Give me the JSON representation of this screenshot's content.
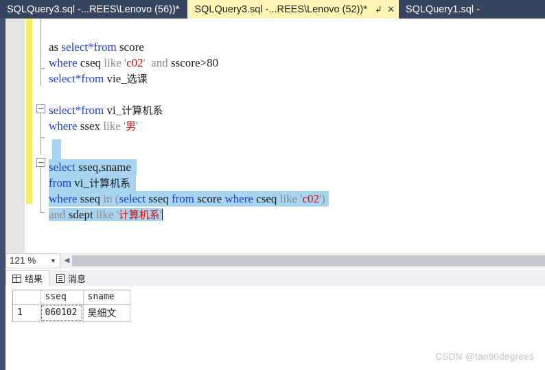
{
  "tabs": [
    {
      "label": "SQLQuery3.sql -...REES\\Lenovo (56))*",
      "active": false
    },
    {
      "label": "SQLQuery3.sql -...REES\\Lenovo (52))*",
      "active": true
    },
    {
      "label": "SQLQuery1.sql -",
      "active": false
    }
  ],
  "tab_icons": {
    "pin": "↲",
    "close": "✕"
  },
  "editor": {
    "lines": [
      "as select*from score",
      "where cseq like 'c02'  and sscore>80",
      "select*from vie_选课",
      "",
      "select*from vi_计算机系",
      "where ssex like '男'",
      "",
      "",
      "select sseq,sname",
      "from vi_计算机系",
      "where sseq in (select sseq from score where cseq like 'c02')",
      "and sdept like '计算机系'"
    ],
    "l1": {
      "w1": "as ",
      "w2": "select*from",
      "w3": " score"
    },
    "l2": {
      "w1": "where",
      "w2": " cseq ",
      "w3": "like",
      "w4": " '",
      "w5": "c02",
      "w6": "'",
      "w7": "  and ",
      "w8": "sscore>80"
    },
    "l3": {
      "w1": "select*from",
      "w2": " vie_",
      "w3": "选课"
    },
    "l5": {
      "w1": "select*from",
      "w2": " vi_",
      "w3": "计算机系"
    },
    "l6": {
      "w1": "where",
      "w2": " ssex ",
      "w3": "like",
      "w4": " '",
      "w5": "男",
      "w6": "'"
    },
    "l9": {
      "w1": "select",
      "w2": " sseq,sname"
    },
    "l10": {
      "w1": "from",
      "w2": " vi_",
      "w3": "计算机系"
    },
    "l11": {
      "w1": "where",
      "w2": " sseq ",
      "w3": "in",
      "w4": " (",
      "w5": "select",
      "w6": " sseq ",
      "w7": "from",
      "w8": " score ",
      "w9": "where",
      "w10": " cseq ",
      "w11": "like",
      "w12": " '",
      "w13": "c02",
      "w14": "')"
    },
    "l12": {
      "w1": "and",
      "w2": " sdept ",
      "w3": "like",
      "w4": " '",
      "w5": "计算机系",
      "w6": "'"
    }
  },
  "status": {
    "zoom": "121 %",
    "zoom_caret": "▼",
    "scroll_left_arrow": "◀"
  },
  "results_tabs": [
    {
      "label": "结果",
      "icon": "grid-icon",
      "active": true
    },
    {
      "label": "消息",
      "icon": "message-icon",
      "active": false
    }
  ],
  "results_grid": {
    "columns": [
      "",
      "sseq",
      "sname"
    ],
    "rows": [
      {
        "num": "1",
        "sseq": "060102",
        "sname": "吴细文"
      }
    ]
  },
  "watermark": "CSDN @tan90degrees",
  "colors": {
    "tab_bar": "#37465e",
    "active_tab": "#fdf6b4",
    "selection": "#a8d4f0",
    "change_bar": "#f7eb6a",
    "keyword": "#1b3fdb",
    "string": "#d01010",
    "operator_gray": "#8c8c8c"
  }
}
